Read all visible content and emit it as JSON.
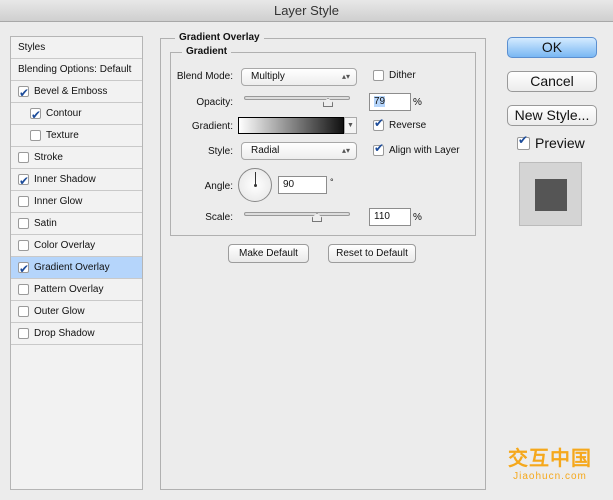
{
  "window": {
    "title": "Layer Style"
  },
  "sidebar": {
    "items": [
      {
        "label": "Styles",
        "checkbox": null,
        "indent": 0
      },
      {
        "label": "Blending Options: Default",
        "checkbox": null,
        "indent": 0
      },
      {
        "label": "Bevel & Emboss",
        "checkbox": true,
        "indent": 0
      },
      {
        "label": "Contour",
        "checkbox": true,
        "indent": 1
      },
      {
        "label": "Texture",
        "checkbox": false,
        "indent": 1
      },
      {
        "label": "Stroke",
        "checkbox": false,
        "indent": 0
      },
      {
        "label": "Inner Shadow",
        "checkbox": true,
        "indent": 0
      },
      {
        "label": "Inner Glow",
        "checkbox": false,
        "indent": 0
      },
      {
        "label": "Satin",
        "checkbox": false,
        "indent": 0
      },
      {
        "label": "Color Overlay",
        "checkbox": false,
        "indent": 0
      },
      {
        "label": "Gradient Overlay",
        "checkbox": true,
        "indent": 0,
        "selected": true
      },
      {
        "label": "Pattern Overlay",
        "checkbox": false,
        "indent": 0
      },
      {
        "label": "Outer Glow",
        "checkbox": false,
        "indent": 0
      },
      {
        "label": "Drop Shadow",
        "checkbox": false,
        "indent": 0
      }
    ]
  },
  "panel": {
    "title": "Gradient Overlay",
    "group_title": "Gradient",
    "blend_mode_label": "Blend Mode:",
    "blend_mode": "Multiply",
    "dither_label": "Dither",
    "dither": false,
    "opacity_label": "Opacity:",
    "opacity": "79",
    "opacity_unit": "%",
    "gradient_label": "Gradient:",
    "reverse_label": "Reverse",
    "reverse": true,
    "style_label": "Style:",
    "style": "Radial",
    "align_label": "Align with Layer",
    "align": true,
    "angle_label": "Angle:",
    "angle": "90",
    "angle_unit": "°",
    "scale_label": "Scale:",
    "scale": "110",
    "scale_unit": "%",
    "make_default": "Make Default",
    "reset_default": "Reset to Default"
  },
  "actions": {
    "ok": "OK",
    "cancel": "Cancel",
    "new_style": "New Style...",
    "preview_label": "Preview",
    "preview": true
  },
  "watermark": {
    "cn": "交互中国",
    "site": "Jiaohucn.com",
    "color": "#f5a81c"
  }
}
